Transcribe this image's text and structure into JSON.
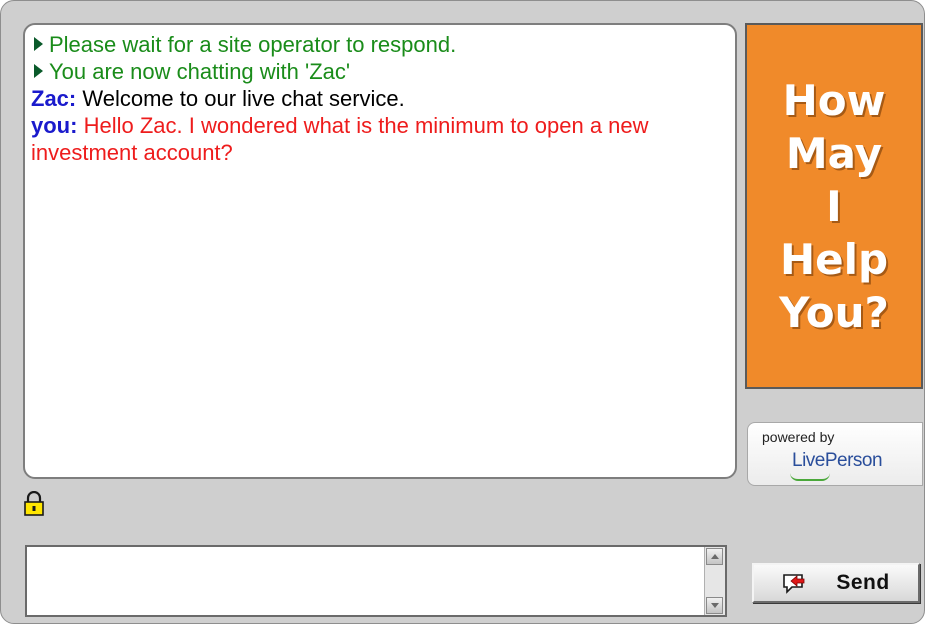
{
  "transcript": {
    "lines": [
      {
        "type": "system",
        "text": "Please wait for a site operator to respond."
      },
      {
        "type": "system",
        "text": "You are now chatting with 'Zac'"
      },
      {
        "type": "agent",
        "speaker": "Zac:",
        "text": "Welcome to our live chat service."
      },
      {
        "type": "visitor",
        "speaker": "you:",
        "text": "Hello Zac. I wondered what is the minimum to open a new investment account?"
      }
    ]
  },
  "banner": {
    "lines": [
      "How",
      "May",
      "I",
      "Help",
      "You?"
    ],
    "bg_color": "#f08a2a"
  },
  "powered": {
    "by_label": "powered by",
    "logo_text": "LivePerson"
  },
  "input": {
    "value": "",
    "placeholder": ""
  },
  "send_button": {
    "label": "Send",
    "icon": "chat-send-icon"
  },
  "colors": {
    "system_text": "#1a8c1a",
    "speaker": "#1a1acc",
    "visitor_text": "#ee1c1c",
    "window_bg": "#cfcfcf"
  },
  "icons": {
    "secure": "lock-icon",
    "system_marker": "play-arrow-icon"
  }
}
